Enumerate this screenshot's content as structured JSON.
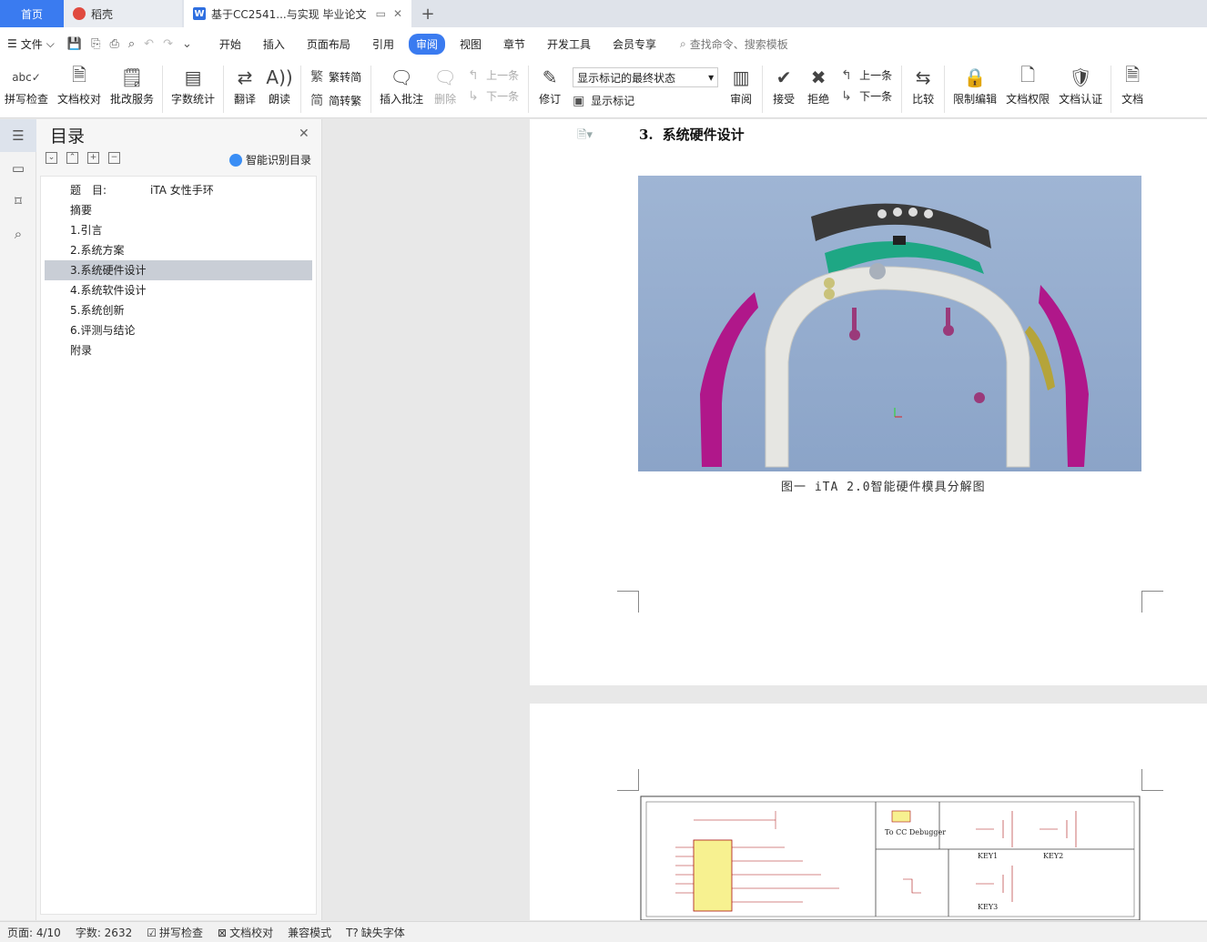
{
  "tabs": {
    "home": "首页",
    "daoke": "稻壳",
    "doc": "基于CC2541...与实现 毕业论文"
  },
  "menubar": {
    "file": "文件",
    "items": [
      "开始",
      "插入",
      "页面布局",
      "引用",
      "审阅",
      "视图",
      "章节",
      "开发工具",
      "会员专享"
    ],
    "search": "查找命令、搜索模板"
  },
  "ribbon": {
    "spell": "拼写检查",
    "proof": "文档校对",
    "correct": "批改服务",
    "wordcount": "字数统计",
    "translate": "翻译",
    "read": "朗读",
    "t2s": "繁转简",
    "s2t": "简转繁",
    "insert_comment": "插入批注",
    "delete": "删除",
    "prev_comment": "上一条",
    "next_comment": "下一条",
    "revise": "修订",
    "markup_state": "显示标记的最终状态",
    "show_markup": "显示标记",
    "review": "审阅",
    "accept": "接受",
    "reject": "拒绝",
    "prev_change": "上一条",
    "next_change": "下一条",
    "compare": "比较",
    "restrict": "限制编辑",
    "permission": "文档权限",
    "certify": "文档认证",
    "more": "文档"
  },
  "toc": {
    "title": "目录",
    "smart": "智能识别目录",
    "title_label": "题　目:",
    "title_value": "iTA 女性手环",
    "items": [
      "摘要",
      "1.引言",
      "2.系统方案",
      "3.系统硬件设计",
      "4.系统软件设计",
      "5.系统创新",
      "6.评测与结论",
      "附录"
    ]
  },
  "document": {
    "heading_num": "3.",
    "heading": "系统硬件设计",
    "caption": "图一 iTA 2.0智能硬件模具分解图",
    "schematic_label": "To CC Debugger",
    "key1": "KEY1",
    "key2": "KEY2",
    "key3": "KEY3"
  },
  "status": {
    "page": "页面: 4/10",
    "words": "字数: 2632",
    "spell": "拼写检查",
    "proof": "文档校对",
    "compat": "兼容模式",
    "missing_font": "缺失字体"
  }
}
